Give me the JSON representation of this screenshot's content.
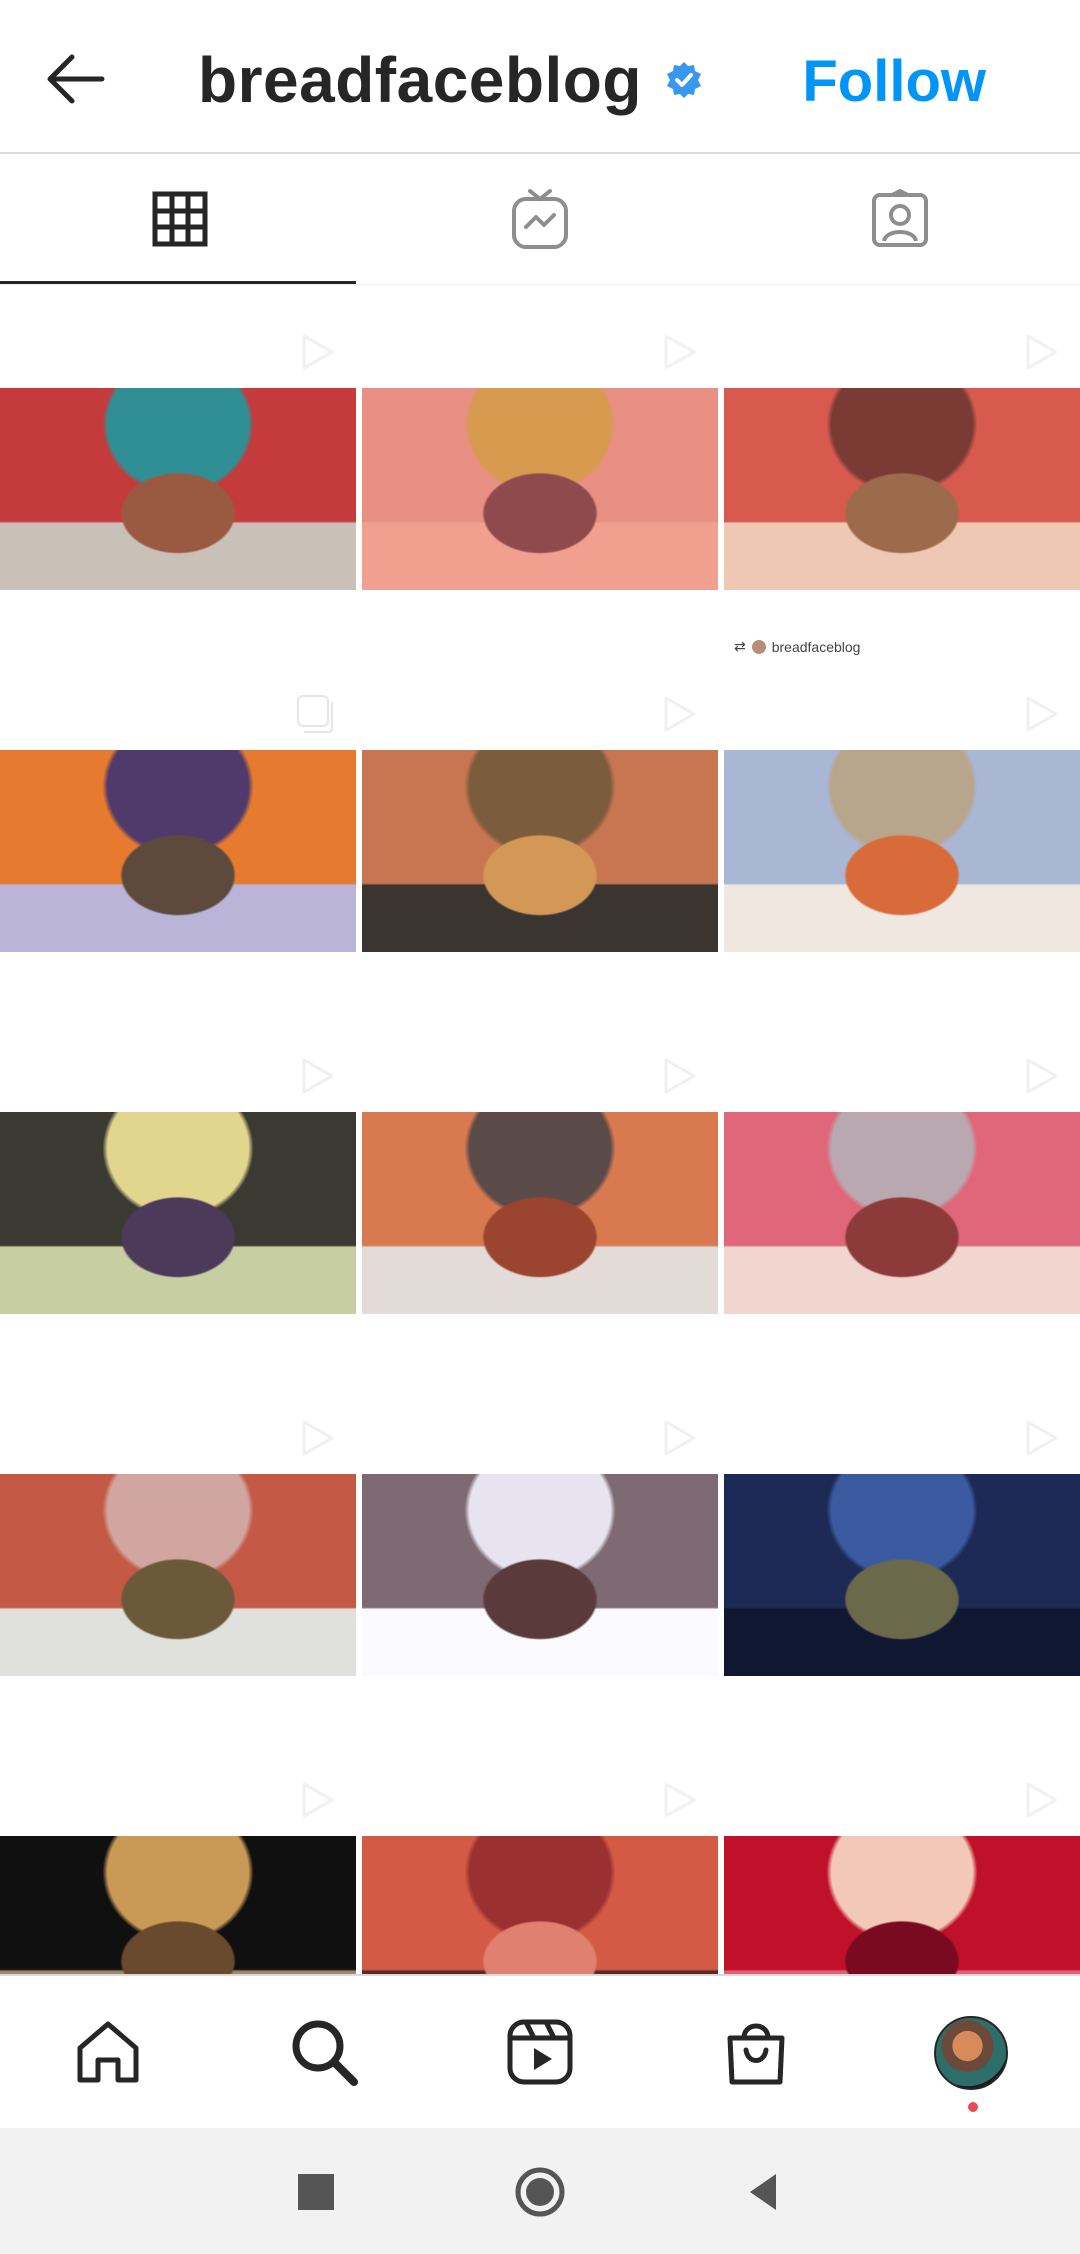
{
  "header": {
    "title": "breadfaceblog",
    "follow_label": "Follow",
    "verified": true,
    "accent_color": "#0095f6"
  },
  "tabs": [
    {
      "icon": "grid-icon",
      "active": true
    },
    {
      "icon": "igtv-icon",
      "active": false
    },
    {
      "icon": "tagged-icon",
      "active": false
    }
  ],
  "grid": {
    "items": [
      {
        "colors": [
          "#c53a3b",
          "#2f8f95",
          "#9a5a42",
          "#c9c0b8"
        ],
        "type": "video"
      },
      {
        "colors": [
          "#e88f84",
          "#d79a4f",
          "#8e4a4d",
          "#f1a090"
        ],
        "type": "video"
      },
      {
        "colors": [
          "#d85a4e",
          "#7a3b34",
          "#9b6b4b",
          "#efc8b4"
        ],
        "type": "video",
        "repost_label": "breadfaceblog"
      },
      {
        "colors": [
          "#e67a2f",
          "#503a6b",
          "#5e4a3c",
          "#b9b4d8"
        ],
        "type": "album"
      },
      {
        "colors": [
          "#c87552",
          "#7b5c3c",
          "#d39856",
          "#3b3532"
        ],
        "type": "video"
      },
      {
        "colors": [
          "#a9b6d4",
          "#b7a58c",
          "#d96b3b",
          "#f0e8e0"
        ],
        "type": "video"
      },
      {
        "colors": [
          "#3a3a32",
          "#e2d68f",
          "#4c3a5a",
          "#c7cfa2"
        ],
        "type": "video"
      },
      {
        "colors": [
          "#d87950",
          "#5a4a48",
          "#9b4430",
          "#e2dbd8"
        ],
        "type": "video"
      },
      {
        "colors": [
          "#e0677a",
          "#b9a8b0",
          "#8c3a3a",
          "#f1d6d0"
        ],
        "type": "video"
      },
      {
        "colors": [
          "#c45a45",
          "#d1a6a0",
          "#6a5a3a",
          "#e0e0dc"
        ],
        "type": "video"
      },
      {
        "colors": [
          "#7d6a72",
          "#e7e4ef",
          "#5a3a3a",
          "#fafaff"
        ],
        "type": "video"
      },
      {
        "colors": [
          "#1c2a55",
          "#3b5aa0",
          "#6a6a4a",
          "#0f1830"
        ],
        "type": "video"
      },
      {
        "colors": [
          "#101010",
          "#c89a55",
          "#6a4a2e",
          "#9c8a6a"
        ],
        "type": "video"
      },
      {
        "colors": [
          "#d35a45",
          "#9b3030",
          "#e08070",
          "#5a2a2a"
        ],
        "type": "video"
      },
      {
        "colors": [
          "#c0102a",
          "#f2c8b8",
          "#7a0a20",
          "#e0607a"
        ],
        "type": "video"
      }
    ]
  }
}
